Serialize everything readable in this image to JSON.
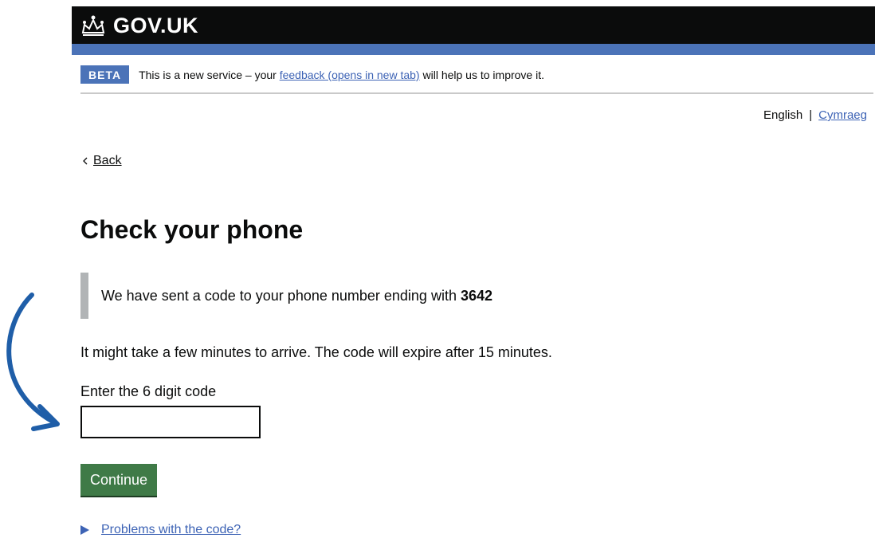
{
  "header": {
    "logo_text": "GOV.UK",
    "logo_icon": "crown-icon",
    "stripe_color": "#4b73b8"
  },
  "phase_banner": {
    "tag": "BETA",
    "text_before": "This is a new service – your",
    "link_text": "feedback (opens in new tab)",
    "text_after": "will help us to improve it."
  },
  "language": {
    "current": "English",
    "separator": "|",
    "other": "Cymraeg"
  },
  "back_link": {
    "label": "Back",
    "icon": "chevron-left-icon"
  },
  "main": {
    "title": "Check your phone",
    "inset_text": "We have sent a code to your phone number ending with",
    "phone_suffix": "3642",
    "hint": "It might take a few minutes to arrive. The code will expire after 15 minutes.",
    "code_label": "Enter the 6 digit code",
    "code_value": "",
    "continue_label": "Continue",
    "problems_link": "Problems with the code?"
  },
  "annotation": {
    "icon": "curved-arrow-icon",
    "color": "#1f5ea8"
  }
}
